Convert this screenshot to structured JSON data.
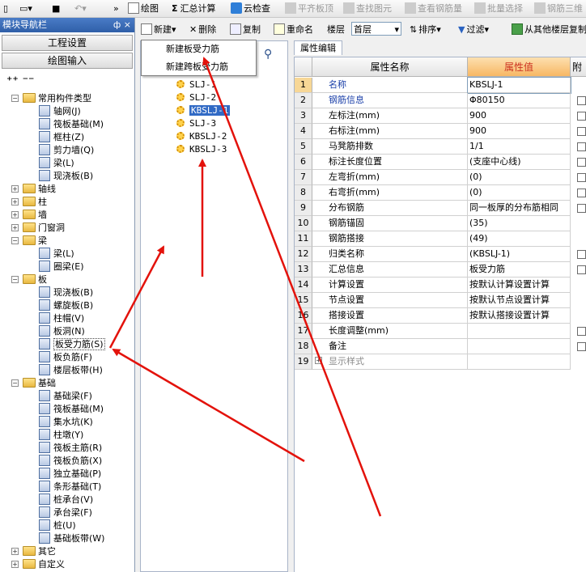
{
  "toolbar": {
    "draw": "绘图",
    "summary": "汇总计算",
    "cloud_check": "云检查",
    "align_slab": "平齐板顶",
    "find_element": "查找图元",
    "view_rebar": "查看钢筋量",
    "batch_select": "批量选择",
    "rebar_3d": "钢筋三维"
  },
  "nav": {
    "title": "模块导航栏",
    "pin": "ф ×",
    "btn_project": "工程设置",
    "btn_draw": "绘图输入",
    "tree": [
      {
        "label": "常用构件类型",
        "type": "folder",
        "level": 0,
        "expanded": true
      },
      {
        "label": "轴网(J)",
        "type": "item",
        "level": 1
      },
      {
        "label": "筏板基础(M)",
        "type": "item",
        "level": 1
      },
      {
        "label": "框柱(Z)",
        "type": "item",
        "level": 1
      },
      {
        "label": "剪力墙(Q)",
        "type": "item",
        "level": 1
      },
      {
        "label": "梁(L)",
        "type": "item",
        "level": 1
      },
      {
        "label": "现浇板(B)",
        "type": "item",
        "level": 1
      },
      {
        "label": "轴线",
        "type": "folder",
        "level": 0,
        "expanded": false
      },
      {
        "label": "柱",
        "type": "folder",
        "level": 0,
        "expanded": false
      },
      {
        "label": "墙",
        "type": "folder",
        "level": 0,
        "expanded": false
      },
      {
        "label": "门窗洞",
        "type": "folder",
        "level": 0,
        "expanded": false
      },
      {
        "label": "梁",
        "type": "folder",
        "level": 0,
        "expanded": true
      },
      {
        "label": "梁(L)",
        "type": "item",
        "level": 1
      },
      {
        "label": "圈梁(E)",
        "type": "item",
        "level": 1
      },
      {
        "label": "板",
        "type": "folder",
        "level": 0,
        "expanded": true
      },
      {
        "label": "现浇板(B)",
        "type": "item",
        "level": 1
      },
      {
        "label": "螺旋板(B)",
        "type": "item",
        "level": 1
      },
      {
        "label": "柱帽(V)",
        "type": "item",
        "level": 1
      },
      {
        "label": "板洞(N)",
        "type": "item",
        "level": 1
      },
      {
        "label": "板受力筋(S)",
        "type": "item",
        "level": 1,
        "selected": true
      },
      {
        "label": "板负筋(F)",
        "type": "item",
        "level": 1
      },
      {
        "label": "楼层板带(H)",
        "type": "item",
        "level": 1
      },
      {
        "label": "基础",
        "type": "folder",
        "level": 0,
        "expanded": true
      },
      {
        "label": "基础梁(F)",
        "type": "item",
        "level": 1
      },
      {
        "label": "筏板基础(M)",
        "type": "item",
        "level": 1
      },
      {
        "label": "集水坑(K)",
        "type": "item",
        "level": 1
      },
      {
        "label": "柱墩(Y)",
        "type": "item",
        "level": 1
      },
      {
        "label": "筏板主筋(R)",
        "type": "item",
        "level": 1
      },
      {
        "label": "筏板负筋(X)",
        "type": "item",
        "level": 1
      },
      {
        "label": "独立基础(P)",
        "type": "item",
        "level": 1
      },
      {
        "label": "条形基础(T)",
        "type": "item",
        "level": 1
      },
      {
        "label": "桩承台(V)",
        "type": "item",
        "level": 1
      },
      {
        "label": "承台梁(F)",
        "type": "item",
        "level": 1
      },
      {
        "label": "桩(U)",
        "type": "item",
        "level": 1
      },
      {
        "label": "基础板带(W)",
        "type": "item",
        "level": 1
      },
      {
        "label": "其它",
        "type": "folder",
        "level": 0,
        "expanded": false
      },
      {
        "label": "自定义",
        "type": "folder",
        "level": 0,
        "expanded": false
      }
    ]
  },
  "mid_toolbar": {
    "new": "新建",
    "delete": "删除",
    "copy": "复制",
    "rename": "重命名",
    "floor_label": "楼层",
    "floor_value": "首层",
    "sort": "排序",
    "filter": "过滤",
    "copy_from_other": "从其他楼层复制"
  },
  "dropdown": {
    "item1": "新建板受力筋",
    "item2": "新建跨板受力筋"
  },
  "components": [
    {
      "name": "SLJ-1"
    },
    {
      "name": "SLJ-2"
    },
    {
      "name": "KBSLJ-1",
      "selected": true
    },
    {
      "name": "SLJ-3"
    },
    {
      "name": "KBSLJ-2"
    },
    {
      "name": "KBSLJ-3"
    }
  ],
  "props": {
    "tab": "属性编辑",
    "col_name": "属性名称",
    "col_value": "属性值",
    "col_extra": "附加",
    "rows": [
      {
        "num": "1",
        "name": "名称",
        "value": "KBSLJ-1",
        "style": "blue",
        "check": false
      },
      {
        "num": "2",
        "name": "钢筋信息",
        "value": "Φ80150",
        "style": "blue",
        "check": true
      },
      {
        "num": "3",
        "name": "左标注(mm)",
        "value": "900",
        "style": "",
        "check": true
      },
      {
        "num": "4",
        "name": "右标注(mm)",
        "value": "900",
        "style": "",
        "check": true
      },
      {
        "num": "5",
        "name": "马凳筋排数",
        "value": "1/1",
        "style": "",
        "check": true
      },
      {
        "num": "6",
        "name": "标注长度位置",
        "value": "(支座中心线)",
        "style": "",
        "check": true
      },
      {
        "num": "7",
        "name": "左弯折(mm)",
        "value": "(0)",
        "style": "",
        "check": true
      },
      {
        "num": "8",
        "name": "右弯折(mm)",
        "value": "(0)",
        "style": "",
        "check": true
      },
      {
        "num": "9",
        "name": "分布钢筋",
        "value": "同一板厚的分布筋相同",
        "style": "",
        "check": true
      },
      {
        "num": "10",
        "name": "钢筋锚固",
        "value": "(35)",
        "style": "",
        "check": false
      },
      {
        "num": "11",
        "name": "钢筋搭接",
        "value": "(49)",
        "style": "",
        "check": false
      },
      {
        "num": "12",
        "name": "归类名称",
        "value": "(KBSLJ-1)",
        "style": "",
        "check": true
      },
      {
        "num": "13",
        "name": "汇总信息",
        "value": "板受力筋",
        "style": "",
        "check": true
      },
      {
        "num": "14",
        "name": "计算设置",
        "value": "按默认计算设置计算",
        "style": "",
        "check": false
      },
      {
        "num": "15",
        "name": "节点设置",
        "value": "按默认节点设置计算",
        "style": "",
        "check": false
      },
      {
        "num": "16",
        "name": "搭接设置",
        "value": "按默认搭接设置计算",
        "style": "",
        "check": false
      },
      {
        "num": "17",
        "name": "长度调整(mm)",
        "value": "",
        "style": "",
        "check": true
      },
      {
        "num": "18",
        "name": "备注",
        "value": "",
        "style": "",
        "check": true
      },
      {
        "num": "19",
        "name": "显示样式",
        "value": "",
        "style": "grey",
        "check": false
      }
    ]
  },
  "colors": {
    "accent": "#316ac5",
    "arrow": "#e3120b",
    "header_value": "#f7b763"
  }
}
